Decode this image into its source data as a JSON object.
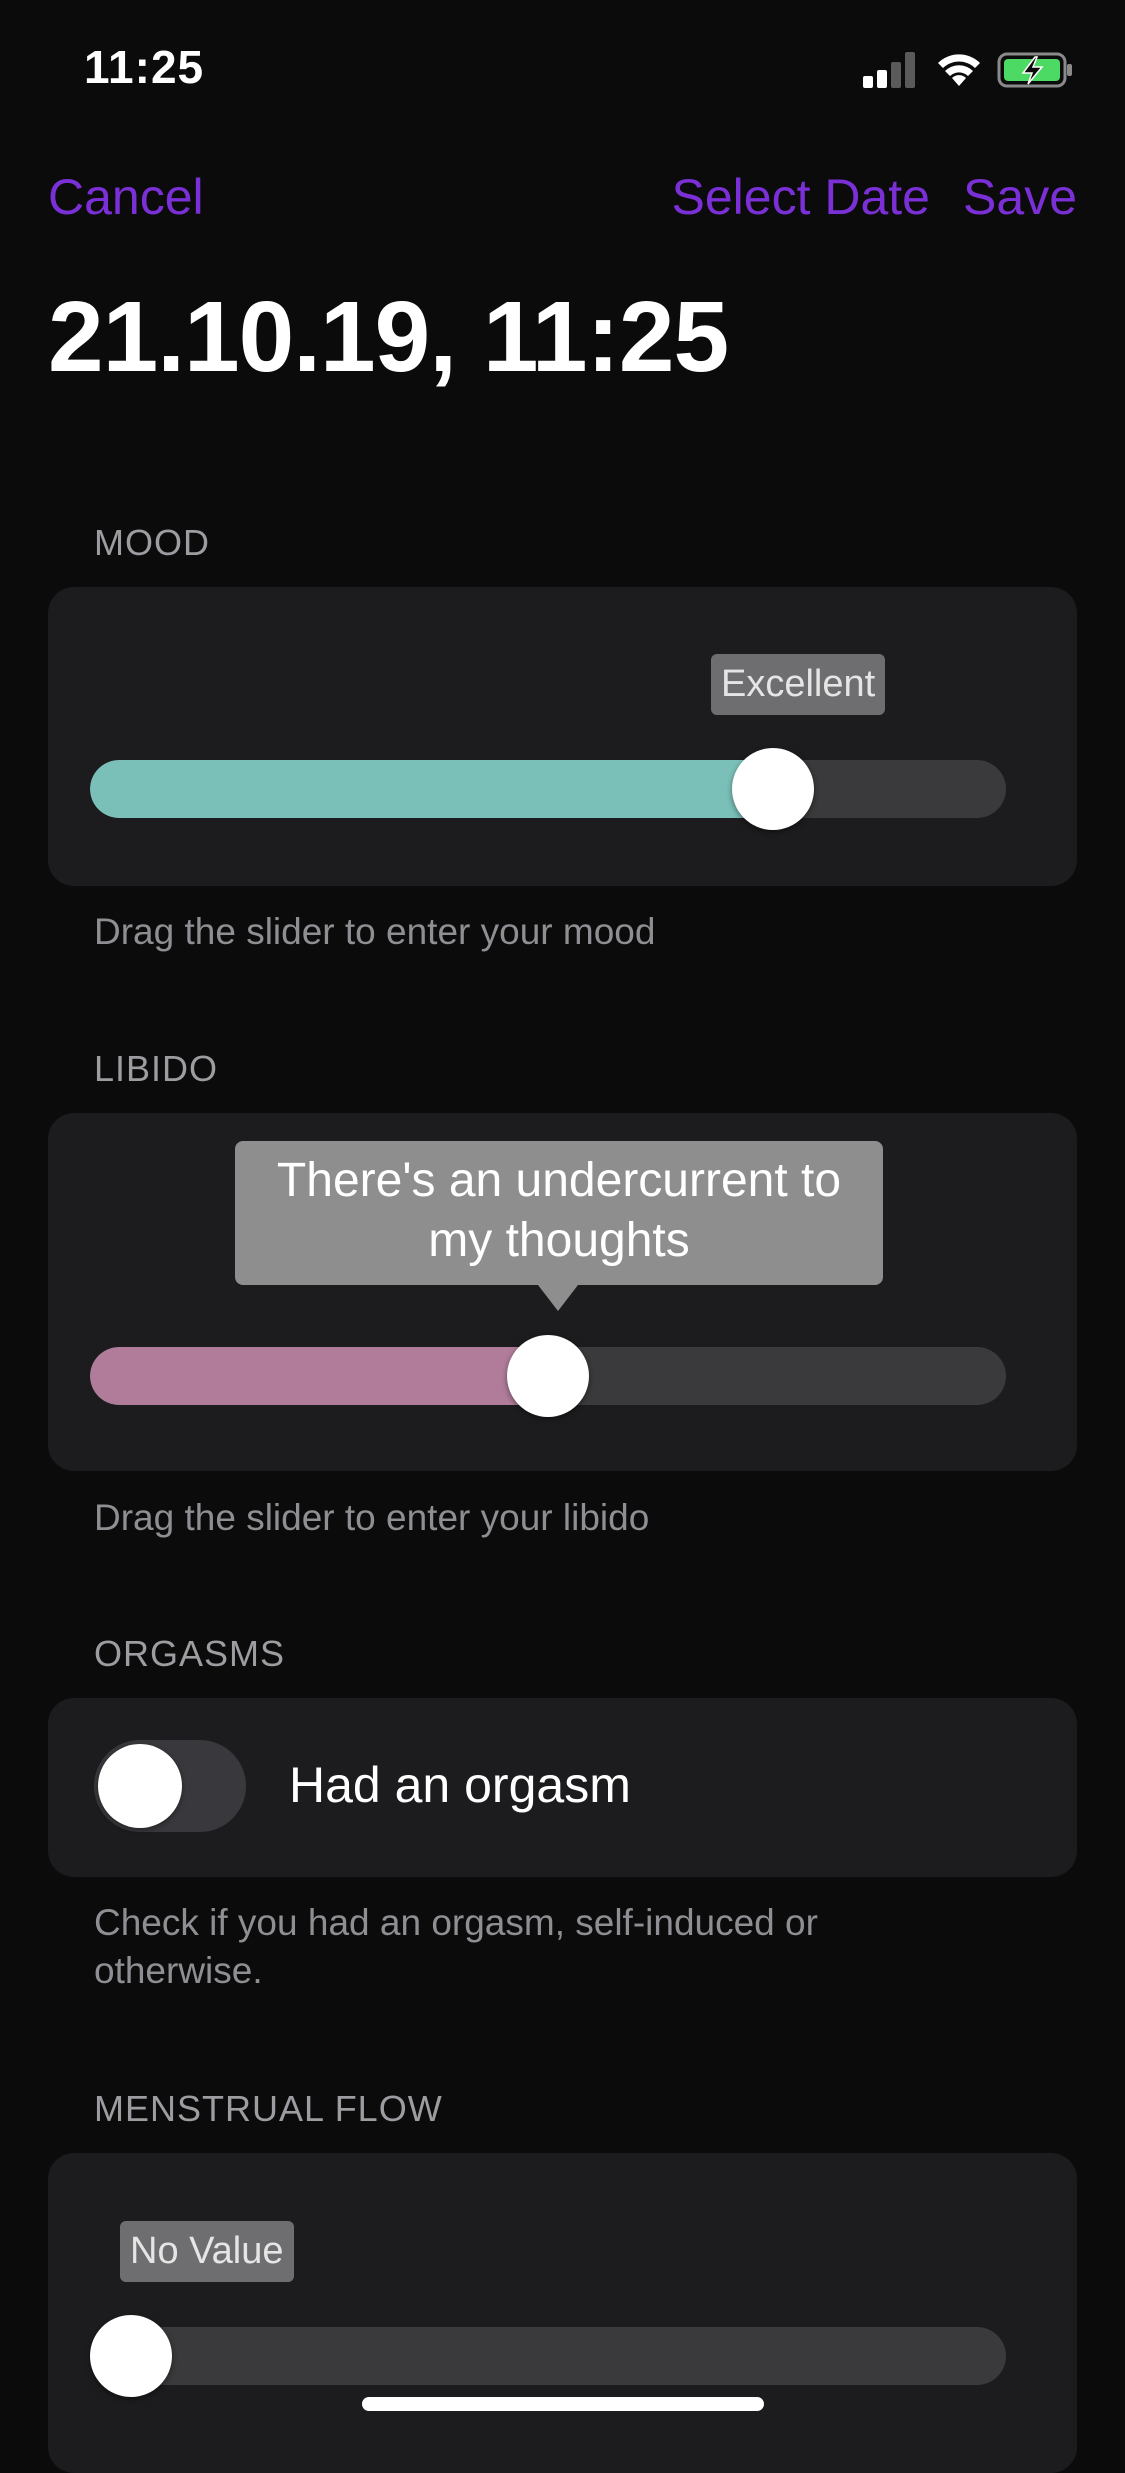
{
  "status_bar": {
    "time": "11:25",
    "icons": [
      "cellular-signal-icon",
      "wifi-icon",
      "battery-charging-icon"
    ]
  },
  "nav": {
    "cancel_label": "Cancel",
    "select_date_label": "Select Date",
    "save_label": "Save"
  },
  "date_title": "21.10.19, 11:25",
  "sections": {
    "mood": {
      "header": "MOOD",
      "value_label": "Excellent",
      "value_fraction": 0.77,
      "fill_color": "#7ac0b8",
      "footer": "Drag the slider to enter your mood"
    },
    "libido": {
      "header": "LIBIDO",
      "tooltip": "There's an undercurrent to my thoughts",
      "value_fraction": 0.5,
      "fill_color": "#b07c9a",
      "footer": "Drag the slider to enter your libido"
    },
    "orgasms": {
      "header": "ORGASMS",
      "toggle_label": "Had an orgasm",
      "toggle_on": false,
      "footer": "Check if you had an orgasm, self-induced or otherwise."
    },
    "menstrual_flow": {
      "header": "MENSTRUAL FLOW",
      "value_label": "No Value",
      "value_fraction": 0
    }
  },
  "colors": {
    "accent": "#7b2fd6",
    "background": "#0b0b0b",
    "card": "#1c1c1e"
  }
}
